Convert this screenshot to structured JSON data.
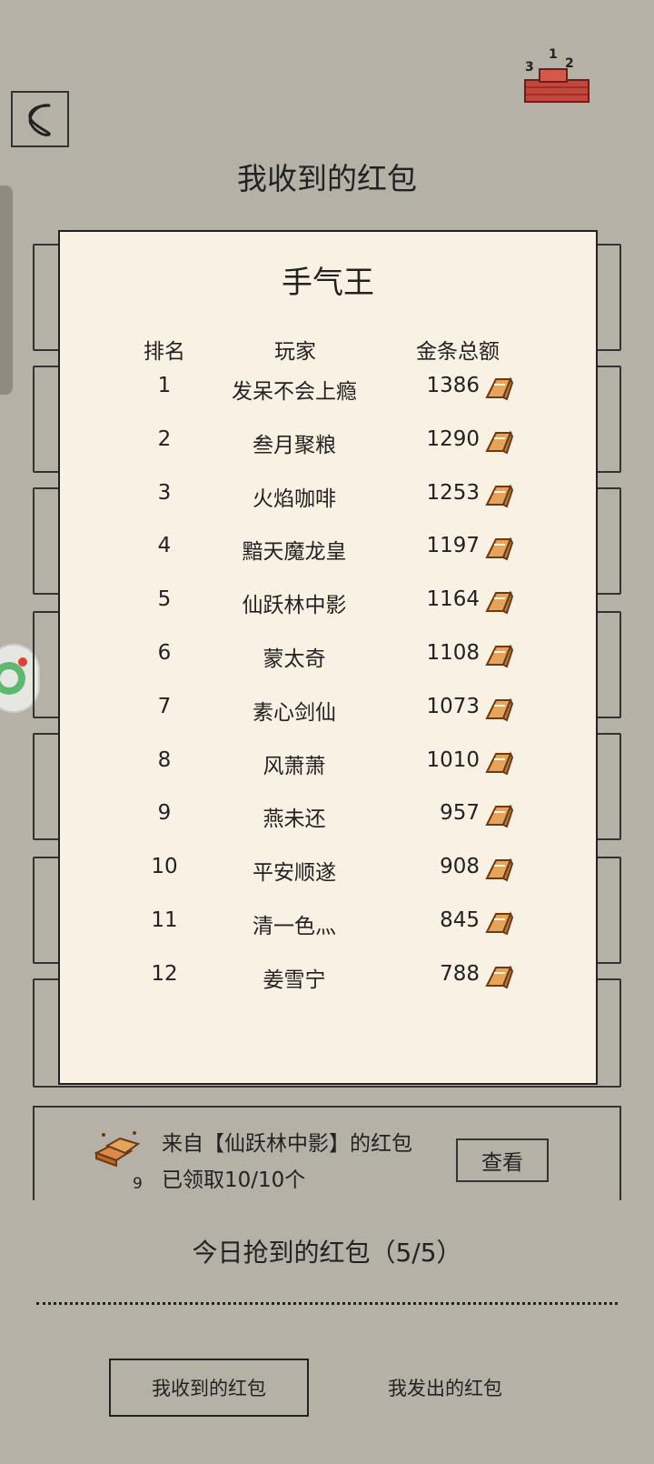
{
  "header": {
    "title": "我收到的红包",
    "back_icon": "back-arrow-icon",
    "rank_icon": "ranking-podium-icon",
    "rank_icon_labels": [
      "3",
      "1",
      "2"
    ]
  },
  "leaderboard": {
    "title": "手气王",
    "columns": [
      "排名",
      "玩家",
      "金条总额"
    ],
    "rows": [
      {
        "rank": "1",
        "player": "发呆不会上瘾",
        "amount": "1386"
      },
      {
        "rank": "2",
        "player": "叁月聚粮",
        "amount": "1290"
      },
      {
        "rank": "3",
        "player": "火焰咖啡",
        "amount": "1253"
      },
      {
        "rank": "4",
        "player": "黯天魔龙皇",
        "amount": "1197"
      },
      {
        "rank": "5",
        "player": "仙跃林中影",
        "amount": "1164"
      },
      {
        "rank": "6",
        "player": "蒙太奇",
        "amount": "1108"
      },
      {
        "rank": "7",
        "player": "素心剑仙",
        "amount": "1073"
      },
      {
        "rank": "8",
        "player": "风萧萧",
        "amount": "1010"
      },
      {
        "rank": "9",
        "player": "燕未还",
        "amount": "957"
      },
      {
        "rank": "10",
        "player": "平安顺遂",
        "amount": "908"
      },
      {
        "rank": "11",
        "player": "清一色灬",
        "amount": "845"
      },
      {
        "rank": "12",
        "player": "姜雪宁",
        "amount": "788"
      }
    ],
    "amount_icon": "gold-bar-icon"
  },
  "notice": {
    "line1": "来自【仙跃林中影】的红包",
    "line2": "已领取10/10个",
    "count": "9",
    "view_label": "查看",
    "icon": "gold-bar-pile-icon"
  },
  "today": "今日抢到的红包（5/5）",
  "tabs": {
    "received": "我收到的红包",
    "sent": "我发出的红包"
  },
  "colors": {
    "background": "#b5b1a6",
    "panel": "#f9f2e4",
    "gold": "#e6a35a"
  }
}
